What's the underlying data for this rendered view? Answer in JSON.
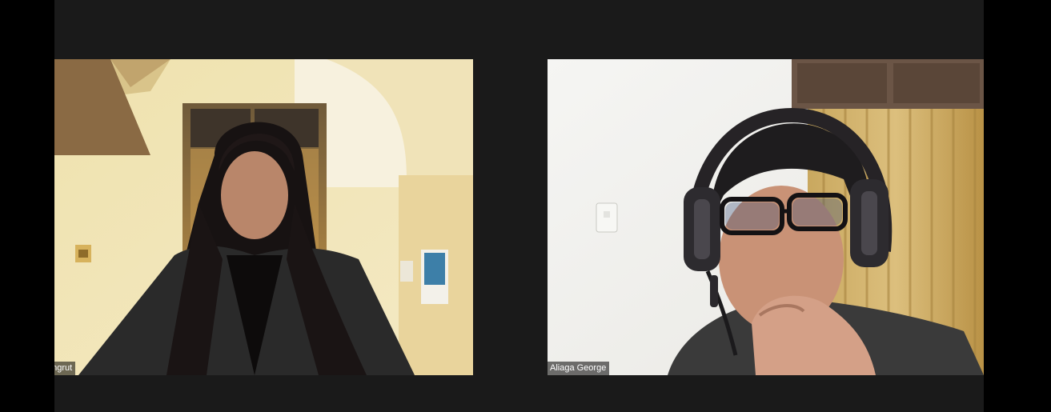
{
  "meeting": {
    "participants": [
      {
        "display_name": "Bongrut",
        "visible_label": "ongrut",
        "video": "on"
      },
      {
        "display_name": "Aliaga George",
        "visible_label": "Aliaga George",
        "video": "on"
      }
    ]
  },
  "colors": {
    "background": "#1a1a1a",
    "outer": "#000000",
    "label_bg": "#000000",
    "label_text": "#ffffff"
  }
}
